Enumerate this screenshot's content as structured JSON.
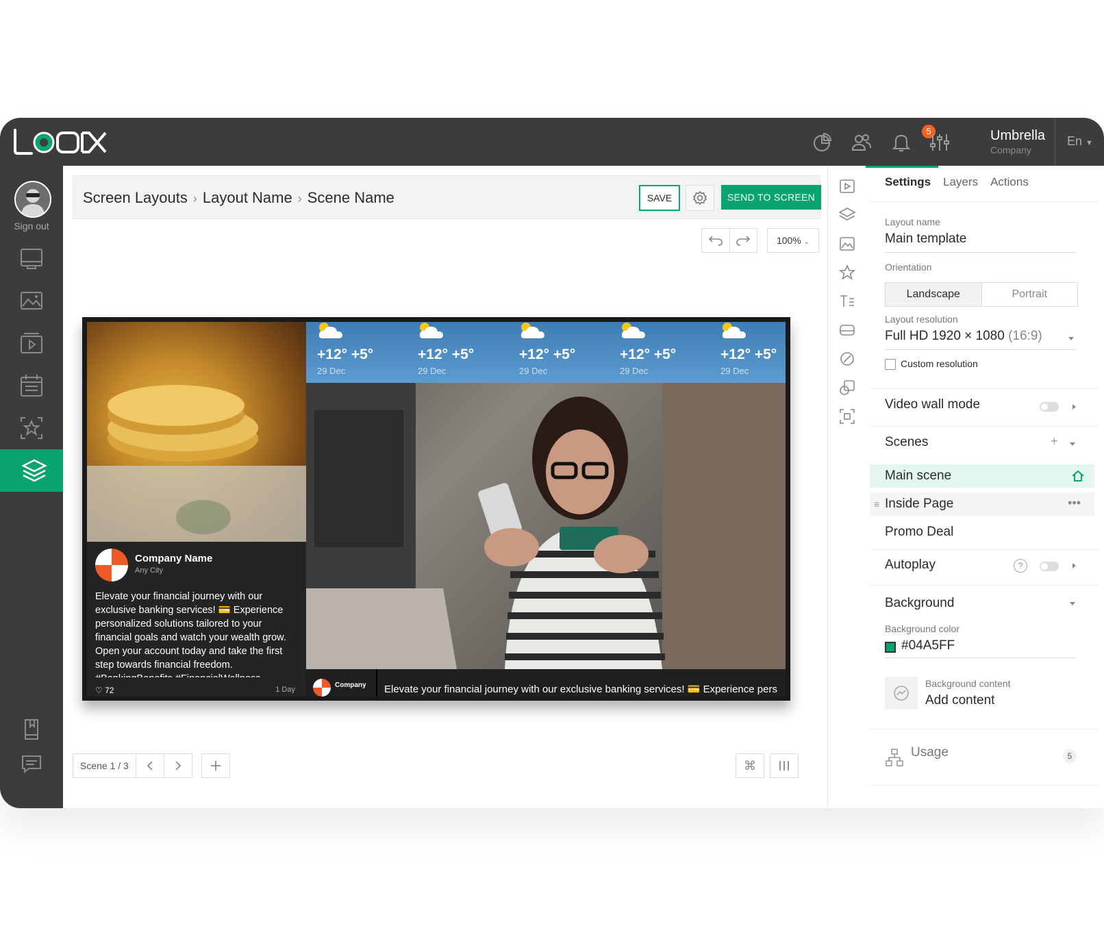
{
  "app": {
    "logo_text": "LOOK"
  },
  "topbar": {
    "notification_count": "5",
    "company_name": "Umbrella",
    "company_sub": "Company",
    "language": "En",
    "icons": [
      "analytics-icon",
      "users-icon",
      "bell-icon",
      "sliders-icon"
    ]
  },
  "sidebar": {
    "signout_label": "Sign out",
    "items": [
      "screens-icon",
      "media-icon",
      "playlists-icon",
      "schedule-icon",
      "templates-icon",
      "layouts-icon",
      "docs-icon",
      "chat-icon"
    ],
    "active": "layouts-icon"
  },
  "breadcrumb": {
    "items": [
      "Screen Layouts",
      "Layout Name",
      "Scene Name"
    ]
  },
  "toolbar": {
    "save_label": "SAVE",
    "send_label": "SEND TO SCREEN",
    "zoom": "100%"
  },
  "preview": {
    "post": {
      "company": "Company Name",
      "city": "Any City",
      "body": "Elevate your financial journey with our exclusive banking services! 💳 Experience personalized solutions tailored to your financial goals and watch your wealth grow. Open your account today and take the first step towards financial freedom. #BankingBenefits #FinancialWellness",
      "likes": "♡ 72",
      "age": "1 Day"
    },
    "weather": [
      {
        "temp": "+12° +5°",
        "date": "29 Dec"
      },
      {
        "temp": "+12° +5°",
        "date": "29 Dec"
      },
      {
        "temp": "+12° +5°",
        "date": "29 Dec"
      },
      {
        "temp": "+12° +5°",
        "date": "29 Dec"
      },
      {
        "temp": "+12° +5°",
        "date": "29 Dec"
      }
    ],
    "ticker": {
      "company": "Company",
      "text": "Elevate your financial journey with our exclusive banking services! 💳 Experience pers"
    }
  },
  "footer": {
    "scene_label": "Scene 1 / 3"
  },
  "panel": {
    "tabs": [
      "Settings",
      "Layers",
      "Actions"
    ],
    "active_tab": "Settings",
    "layout_name_label": "Layout name",
    "layout_name": "Main template",
    "orientation_label": "Orientation",
    "orientation_options": [
      "Landscape",
      "Portrait"
    ],
    "orientation_selected": "Landscape",
    "resolution_label": "Layout resolution",
    "resolution_value": "Full HD 1920 × 1080",
    "resolution_ratio": "(16:9)",
    "custom_resolution_label": "Custom resolution",
    "video_wall_label": "Video wall mode",
    "scenes_label": "Scenes",
    "scenes": [
      "Main scene",
      "Inside Page",
      "Promo Deal"
    ],
    "selected_scene": "Main scene",
    "autoplay_label": "Autoplay",
    "background_label": "Background",
    "background_color_label": "Background color",
    "background_color": "#04A5FF",
    "background_content_label": "Background content",
    "add_content_label": "Add content",
    "usage_label": "Usage",
    "usage_count": "5",
    "accent_color": "#0aa56f"
  }
}
